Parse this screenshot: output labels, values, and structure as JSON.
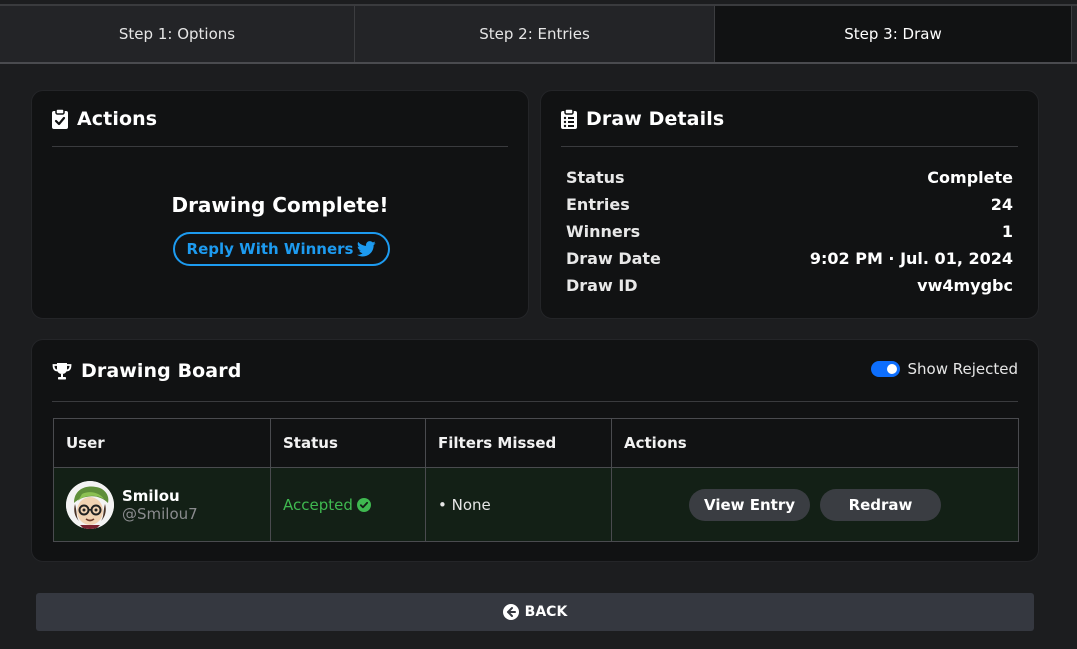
{
  "tabs": [
    "Step 1: Options",
    "Step 2: Entries",
    "Step 3: Draw"
  ],
  "actions": {
    "title": "Actions",
    "complete_text": "Drawing Complete!",
    "reply_label": "Reply With Winners"
  },
  "details": {
    "title": "Draw Details",
    "rows": [
      {
        "key": "Status",
        "value": "Complete"
      },
      {
        "key": "Entries",
        "value": "24"
      },
      {
        "key": "Winners",
        "value": "1"
      },
      {
        "key": "Draw Date",
        "value": "9:02 PM · Jul. 01, 2024"
      },
      {
        "key": "Draw ID",
        "value": "vw4mygbc"
      }
    ]
  },
  "board": {
    "title": "Drawing Board",
    "toggle_label": "Show Rejected",
    "toggle_on": true,
    "columns": [
      "User",
      "Status",
      "Filters Missed",
      "Actions"
    ],
    "rows": [
      {
        "name": "Smilou",
        "handle": "@Smilou7",
        "status": "Accepted",
        "filters_missed": "• None",
        "view_label": "View Entry",
        "redraw_label": "Redraw"
      }
    ]
  },
  "back_label": "BACK",
  "colors": {
    "accent_blue": "#1d9bf0",
    "accepted_green": "#3fb950",
    "toggle_blue": "#0d6efd"
  },
  "icons": {
    "actions": "clipboard-check-icon",
    "details": "clipboard-list-icon",
    "board": "trophy-icon",
    "reply": "twitter-bird-icon",
    "accepted": "check-circle-icon",
    "back": "arrow-left-circle-icon"
  }
}
